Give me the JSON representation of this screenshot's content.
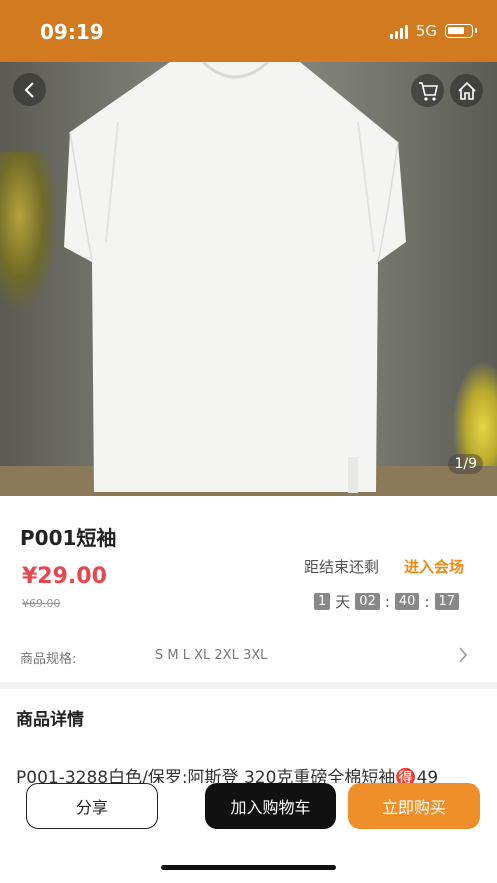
{
  "status_bar": {
    "time": "09:19",
    "network": "5G",
    "battery_level": 0.75
  },
  "colors": {
    "accent": "#d17a20",
    "price": "#e8474f",
    "buy_button": "#ef8f2a",
    "link": "#ef8a13"
  },
  "product": {
    "image_indicator": "1/9",
    "title": "P001短袖",
    "price": "¥29.00",
    "original_price": "¥69.00",
    "countdown_label": "距结束还剩",
    "enter_venue": "进入会场",
    "countdown": {
      "days": "1",
      "day_unit": "天",
      "hours": "02",
      "sep1": ":",
      "minutes": "40",
      "sep2": ":",
      "seconds": "17"
    },
    "spec_label": "商品规格:",
    "spec_value": "S M L XL 2XL 3XL"
  },
  "details": {
    "heading": "商品详情",
    "text": "P001-3288白色/保罗:阿斯登 320克重磅全棉短袖🉐49"
  },
  "actions": {
    "share": "分享",
    "add_to_cart": "加入购物车",
    "buy_now": "立即购买"
  },
  "icons": {
    "back": "chevron-left-icon",
    "cart": "cart-icon",
    "home": "home-icon",
    "spec_arrow": "chevron-right-icon"
  }
}
